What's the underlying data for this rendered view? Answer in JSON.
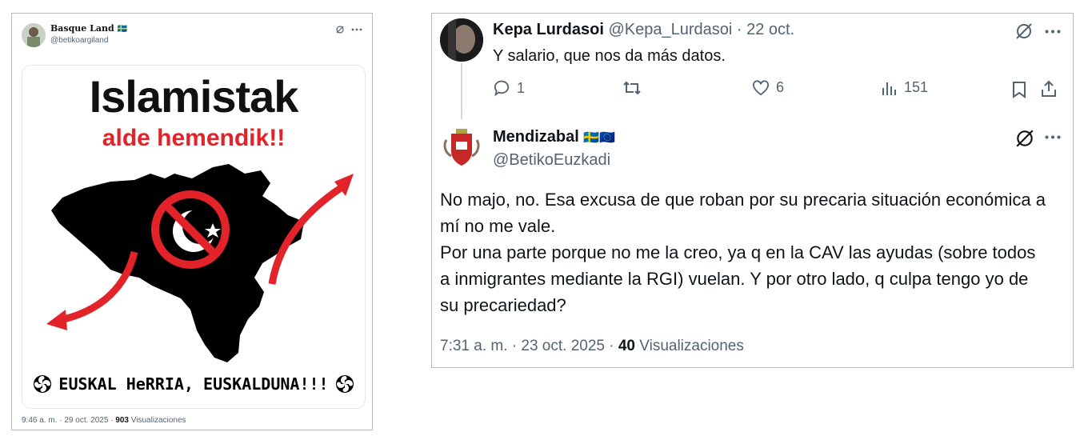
{
  "left": {
    "author_name": "Basque Land",
    "author_flag": "🇸🇪",
    "author_handle": "@betikoargiland",
    "image": {
      "title": "Islamistak",
      "subtitle": "alde hemendik!!",
      "footer": "EUSKAL HeRRIA, EUSKALDUNA!!!"
    },
    "meta": {
      "time": "9:46 a. m. · 29 oct. 2025 · ",
      "views_count": "903",
      "views_label": " Visualizaciones"
    }
  },
  "right": {
    "reply": {
      "author_name": "Kepa Lurdasoi",
      "author_handle": "@Kepa_Lurdasoi",
      "date": "· 22 oct.",
      "text": "Y salario, que nos da más datos.",
      "replies": "1",
      "likes": "6",
      "views": "151"
    },
    "main": {
      "author_name": "Mendizabal",
      "author_flags": "🇸🇪🇪🇺",
      "author_handle": "@BetikoEuzkadi",
      "text": "No majo, no. Esa excusa de que roban por su precaria situación económica a mí no me vale.\nPor una parte porque no me la creo, ya q en la CAV las ayudas (sobre todos a inmigrantes mediante la RGI) vuelan. Y por otro lado, q culpa tengo yo de su precariedad?",
      "time": "7:31 a. m. · 23 oct. 2025 · ",
      "views_count": "40",
      "views_label": " Visualizaciones"
    }
  },
  "colors": {
    "text": "#0f1419",
    "muted": "#536471",
    "border": "#cfd9de",
    "red": "#e2232a",
    "black": "#000000"
  },
  "icons": [
    "grok-icon",
    "more-icon",
    "reply-icon",
    "retweet-icon",
    "like-icon",
    "views-icon",
    "bookmark-icon",
    "share-icon",
    "lauburu-icon"
  ]
}
